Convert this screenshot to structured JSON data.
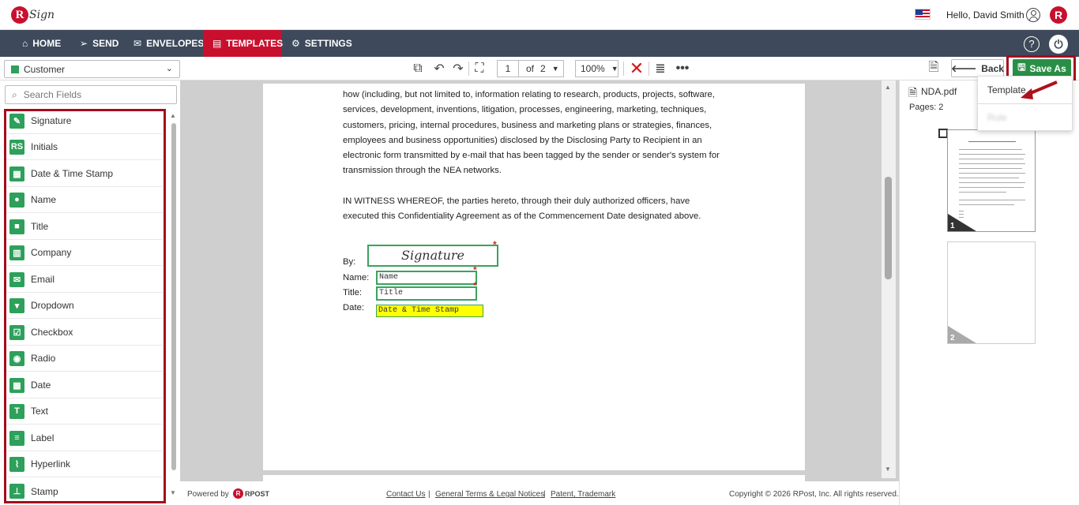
{
  "app": {
    "logo_letter": "R",
    "logo_text": "Sign",
    "greeting": "Hello, David Smith",
    "brand_letter": "R"
  },
  "nav": {
    "items": [
      {
        "label": "HOME",
        "icon": "home-icon"
      },
      {
        "label": "SEND",
        "icon": "send-icon"
      },
      {
        "label": "ENVELOPES",
        "icon": "envelope-icon"
      },
      {
        "label": "TEMPLATES",
        "icon": "template-icon"
      },
      {
        "label": "SETTINGS",
        "icon": "gear-icon"
      }
    ],
    "active": "TEMPLATES",
    "help": "?",
    "power": "⏻"
  },
  "toolbar": {
    "recipient": "Customer",
    "recipient_color": "#2ea05b",
    "page_current": "1",
    "page_of": "of",
    "page_total": "2",
    "zoom": "100%",
    "back_label": "Back",
    "save_as_label": "Save As"
  },
  "save_menu": {
    "options": [
      "Template",
      "Rule"
    ]
  },
  "fields": {
    "search_placeholder": "Search Fields",
    "items": [
      "Signature",
      "Initials",
      "Date & Time Stamp",
      "Name",
      "Title",
      "Company",
      "Email",
      "Dropdown",
      "Checkbox",
      "Radio",
      "Date",
      "Text",
      "Label",
      "Hyperlink",
      "Stamp"
    ]
  },
  "document": {
    "lines": [
      "how (including, but not limited to, information relating to research, products, projects, software,",
      "services, development, inventions, litigation, processes, engineering, marketing, techniques,",
      "customers, pricing, internal procedures, business and marketing plans or strategies, finances,",
      "employees and business opportunities) disclosed by the Disclosing Party to Recipient in an",
      "electronic form transmitted by e-mail that has been tagged by the sender or sender's system for",
      "transmission through the NEA networks."
    ],
    "witness_lines": [
      "IN WITNESS WHEREOF, the parties hereto, through their duly authorized officers, have",
      "executed this Confidentiality Agreement as of the Commencement Date designated above."
    ],
    "labels": {
      "by": "By:",
      "name": "Name:",
      "title": "Title:",
      "date": "Date:"
    },
    "placed_fields": {
      "signature": "Signature",
      "name": "Name",
      "title": "Title",
      "date": "Date & Time Stamp"
    },
    "required_mark": "*"
  },
  "right_panel": {
    "file_name": "NDA.pdf",
    "pages_label": "Pages: 2",
    "thumb_pages": [
      "1",
      "2"
    ]
  },
  "footer": {
    "powered_by": "Powered by",
    "powered_brand": "RPOST",
    "links": [
      "Contact Us",
      "General Terms & Legal Notices",
      "Patent, Trademark"
    ],
    "separator": "|",
    "copyright": "Copyright © 2026 RPost, Inc. All rights reserved."
  }
}
